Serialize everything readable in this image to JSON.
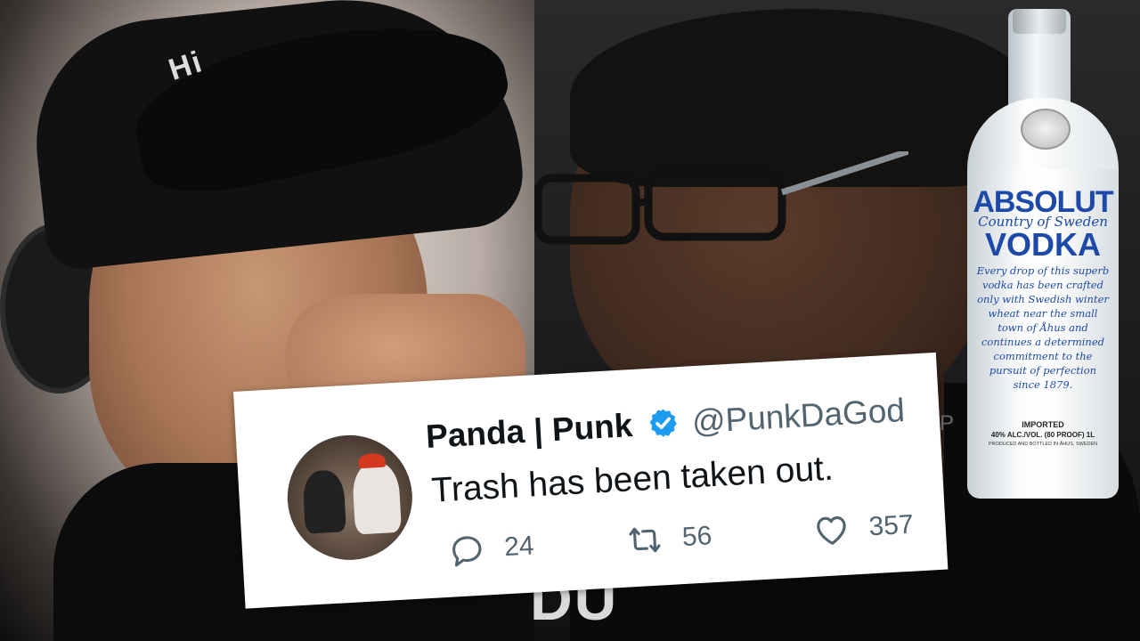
{
  "tweet": {
    "display_name": "Panda | Punk",
    "handle": "@PunkDaGod",
    "text": "Trash has been taken out.",
    "replies": "24",
    "retweets": "56",
    "likes": "357",
    "verified_color": "#1d9bf0"
  },
  "bottle": {
    "brand_line1": "ABSOLUT",
    "brand_line2": "Country of Sweden",
    "brand_line3": "VODKA",
    "blurb": "Every drop of this superb vodka has been crafted only with Swedish winter wheat near the small town of Åhus and continues a determined commitment to the pursuit of perfection since 1879.",
    "imported": "IMPORTED",
    "alcohol": "40% ALC./VOL. (80 PROOF) 1L",
    "produced": "PRODUCED AND BOTTLED IN ÅHUS, SWEDEN"
  },
  "background": {
    "cap_logo": "Hi",
    "shirt_print": "DU",
    "watermark": "P  IN"
  },
  "colors": {
    "tweet_text": "#0f1419",
    "tweet_secondary": "#536471",
    "absolut_blue": "#1d4aa8"
  }
}
